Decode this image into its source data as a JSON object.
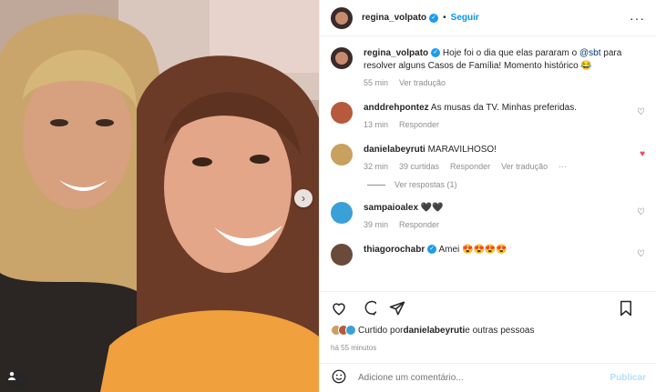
{
  "header": {
    "username": "regina_volpato",
    "follow_label": "Seguir",
    "more": "···"
  },
  "caption": {
    "username": "regina_volpato",
    "text_before": "Hoje foi o dia que elas pararam o ",
    "mention": "@sbt",
    "text_after": " para resolver alguns Casos de Família! Momento histórico 😂",
    "time": "55 min",
    "translate": "Ver tradução"
  },
  "comments": [
    {
      "username": "anddrehpontez",
      "text": "As musas da TV. Minhas preferidas.",
      "time": "13 min",
      "reply": "Responder",
      "liked": false,
      "avatar_color": "#b55a3c"
    },
    {
      "username": "danielabeyruti",
      "text": "MARAVILHOSO!",
      "time": "32 min",
      "likes": "39 curtidas",
      "reply": "Responder",
      "translate": "Ver tradução",
      "more": "···",
      "liked": true,
      "avatar_color": "#c8a060",
      "view_replies": "Ver respostas (1)"
    },
    {
      "username": "sampaioalex",
      "text": "🖤🖤",
      "time": "39 min",
      "reply": "Responder",
      "liked": false,
      "avatar_color": "#3aa0d8"
    },
    {
      "username": "thiagorochabr",
      "text": "Amei 😍😍😍😍",
      "liked": false,
      "avatar_color": "#6a4a3a"
    }
  ],
  "likes": {
    "prefix": "Curtido por ",
    "user": "danielabeyruti",
    "suffix": " e outras pessoas"
  },
  "timestamp": "há 55 minutos",
  "add_comment": {
    "placeholder": "Adicione um comentário...",
    "publish": "Publicar"
  },
  "colors": {
    "link": "#0095f6",
    "heart_red": "#ed4956",
    "muted": "#8e8e8e"
  }
}
